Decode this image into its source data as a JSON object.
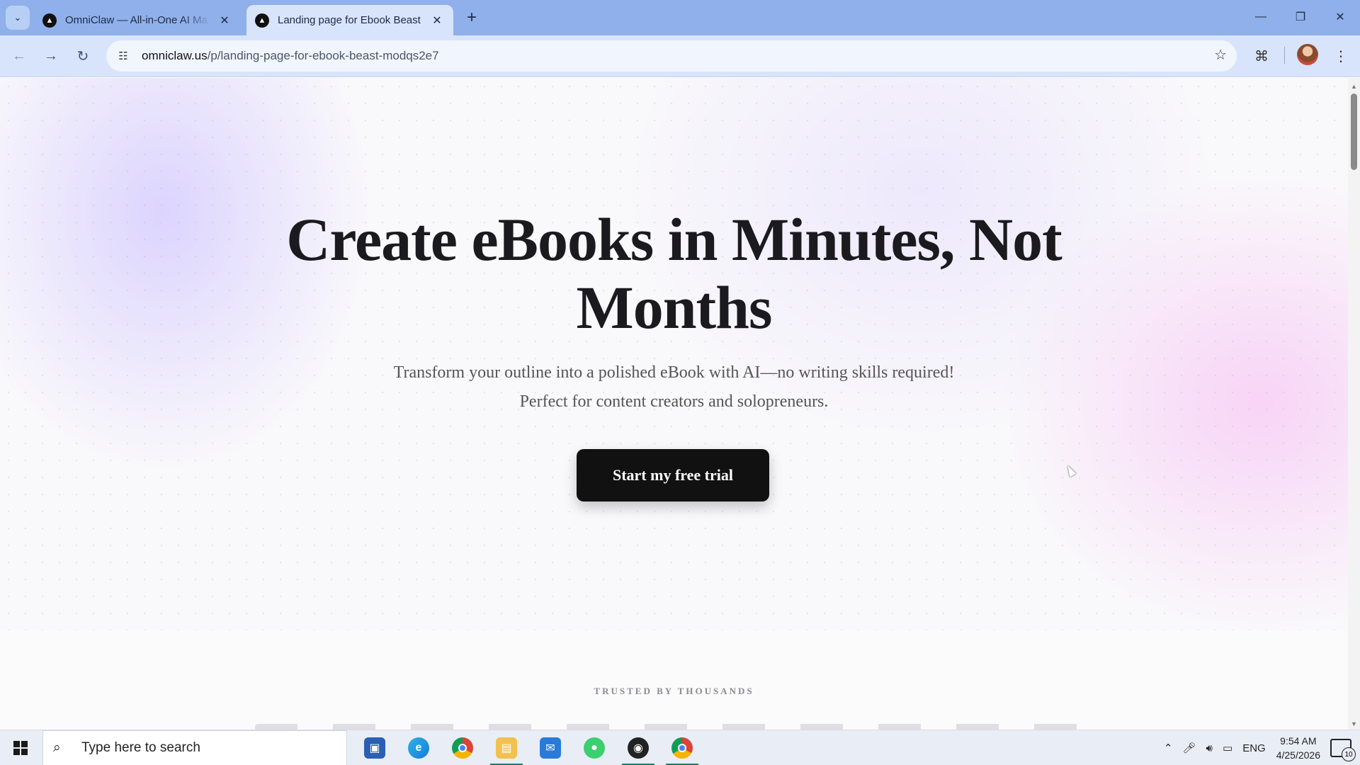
{
  "browser": {
    "tabs": [
      {
        "title": "OmniClaw — All-in-One AI Ma",
        "active": false
      },
      {
        "title": "Landing page for Ebook Beast",
        "active": true
      }
    ],
    "url_host": "omniclaw.us",
    "url_path": "/p/landing-page-for-ebook-beast-modqs2e7"
  },
  "page": {
    "hero_title_line1": "Create eBooks in Minutes, Not",
    "hero_title_line2": "Months",
    "hero_sub_line1": "Transform your outline into a polished eBook with AI—no writing skills required!",
    "hero_sub_line2": "Perfect for content creators and solopreneurs.",
    "cta_label": "Start my free trial",
    "trusted_label": "TRUSTED BY THOUSANDS"
  },
  "taskbar": {
    "search_placeholder": "Type here to search",
    "language": "ENG",
    "time": "9:54 AM",
    "date": "4/25/2026",
    "notification_count": "10"
  },
  "icons": {
    "accent_blue": "#8fb0ea",
    "cta_bg": "#111111"
  }
}
